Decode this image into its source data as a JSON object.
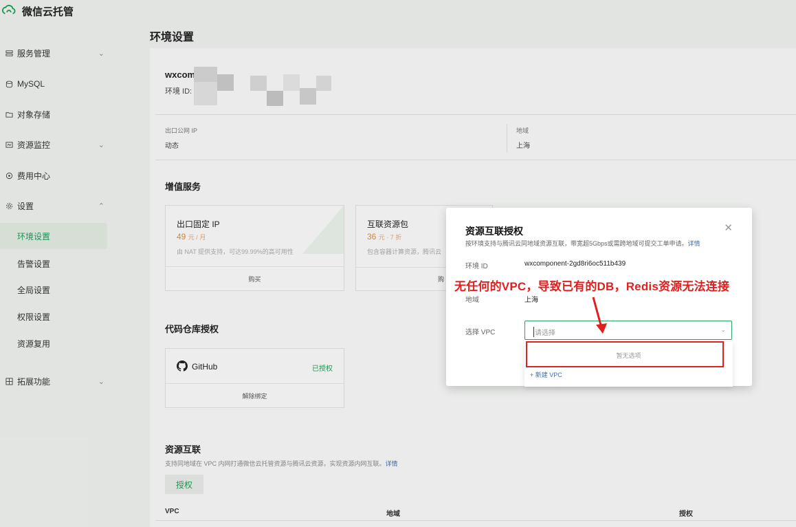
{
  "brand": {
    "name": "微信云托管"
  },
  "sidebar": {
    "items": [
      {
        "label": "服务管理",
        "icon": "server-icon",
        "chevron": "⌄"
      },
      {
        "label": "MySQL",
        "icon": "database-icon",
        "chevron": ""
      },
      {
        "label": "对象存储",
        "icon": "folder-icon",
        "chevron": ""
      },
      {
        "label": "资源监控",
        "icon": "monitor-icon",
        "chevron": "⌄"
      },
      {
        "label": "费用中心",
        "icon": "coin-icon",
        "chevron": ""
      },
      {
        "label": "设置",
        "icon": "gear-icon",
        "chevron": "⌃"
      }
    ],
    "sub_items": [
      "环境设置",
      "告警设置",
      "全局设置",
      "权限设置",
      "资源复用"
    ],
    "extensions": {
      "label": "拓展功能",
      "chevron": "⌄"
    }
  },
  "page": {
    "title": "环境设置"
  },
  "env": {
    "name": "wxcom",
    "id_label": "环境 ID:",
    "egress_ip_label": "出口公网 IP",
    "egress_ip_value": "动态",
    "region_label": "地域",
    "region_value": "上海"
  },
  "value_services": {
    "title": "增值服务",
    "cards": [
      {
        "title": "出口固定 IP",
        "price": "49",
        "unit": "元 / 月",
        "desc": "由 NAT 提供支持，可达99.99%的高可用性",
        "button": "购买"
      },
      {
        "title": "互联资源包",
        "price": "36",
        "unit": "元 · 7 折",
        "desc": "包含容器计算资源，腾讯云",
        "button": "购"
      }
    ]
  },
  "code_repo": {
    "title": "代码仓库授权",
    "provider": "GitHub",
    "status": "已授权",
    "unbind": "解除绑定"
  },
  "resource_link": {
    "title": "资源互联",
    "desc": "支持同地域在 VPC 内网打通微信云托管资源与腾讯云资源，实现资源内网互联。",
    "desc_link": "详情",
    "auth_button": "授权",
    "table_headers": [
      "VPC",
      "地域",
      "授权"
    ]
  },
  "modal": {
    "title": "资源互联授权",
    "subtitle": "按环境支持与腾讯云同地域资源互联，带宽超5Gbps或需跨地域可提交工单申请。",
    "subtitle_link": "详情",
    "env_id_label": "环境 ID",
    "env_id_value": "wxcomponent-2gd8ri6oc511b439",
    "region_label": "地域",
    "region_value": "上海",
    "vpc_label": "选择 VPC",
    "vpc_placeholder": "请选择",
    "dropdown_empty": "暂无选项",
    "dropdown_new": "+ 新建 VPC"
  },
  "annotation": {
    "text": "无任何的VPC，导致已有的DB，Redis资源无法连接",
    "color": "#e01f1f"
  },
  "colors": {
    "accent": "#1a9e57",
    "link": "#3c6db3",
    "price": "#e58a36",
    "annotation": "#e01f1f"
  }
}
